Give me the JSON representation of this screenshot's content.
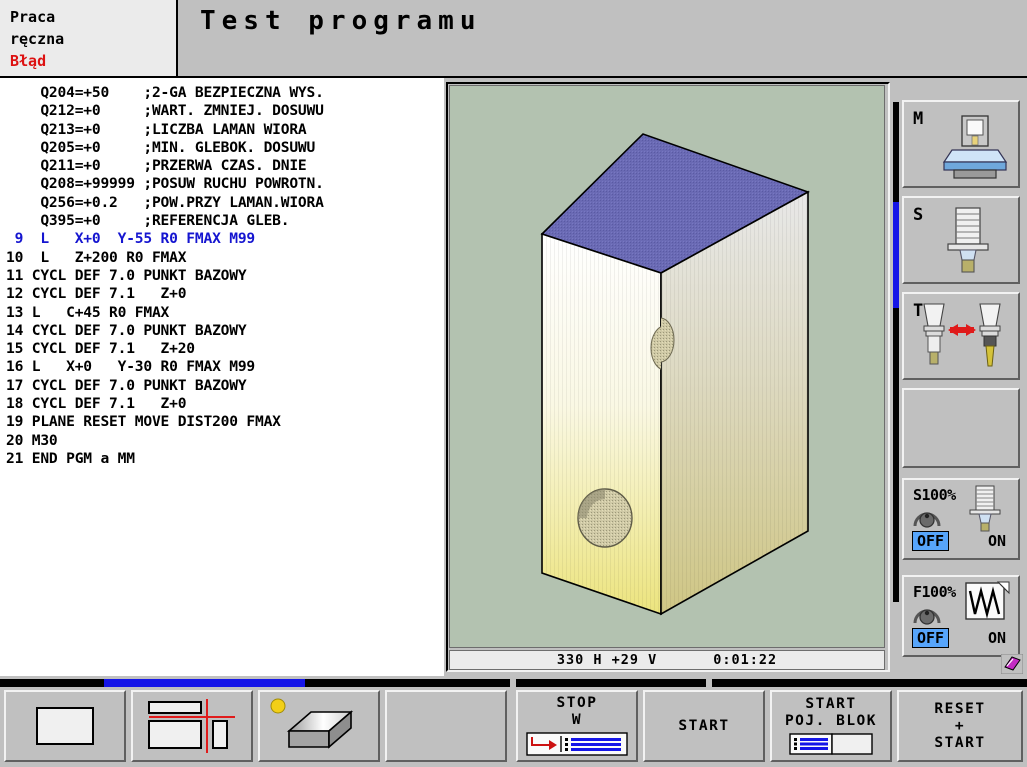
{
  "header": {
    "mode_line1": "Praca",
    "mode_line2": "ręczna",
    "status": "Błąd",
    "title": "Test programu",
    "error_color": "#dd1111"
  },
  "program": {
    "lines": [
      {
        "text": "    Q204=+50    ;2-GA BEZPIECZNA WYS.",
        "highlight": false
      },
      {
        "text": "    Q212=+0     ;WART. ZMNIEJ. DOSUWU",
        "highlight": false
      },
      {
        "text": "    Q213=+0     ;LICZBA LAMAN WIORA",
        "highlight": false
      },
      {
        "text": "    Q205=+0     ;MIN. GLEBOK. DOSUWU",
        "highlight": false
      },
      {
        "text": "    Q211=+0     ;PRZERWA CZAS. DNIE",
        "highlight": false
      },
      {
        "text": "    Q208=+99999 ;POSUW RUCHU POWROTN.",
        "highlight": false
      },
      {
        "text": "    Q256=+0.2   ;POW.PRZY LAMAN.WIORA",
        "highlight": false
      },
      {
        "text": "    Q395=+0     ;REFERENCJA GLEB.",
        "highlight": false
      },
      {
        "text": " 9  L   X+0  Y-55 R0 FMAX M99",
        "highlight": true
      },
      {
        "text": "10  L   Z+200 R0 FMAX",
        "highlight": false
      },
      {
        "text": "11 CYCL DEF 7.0 PUNKT BAZOWY",
        "highlight": false
      },
      {
        "text": "12 CYCL DEF 7.1   Z+0",
        "highlight": false
      },
      {
        "text": "13 L   C+45 R0 FMAX",
        "highlight": false
      },
      {
        "text": "14 CYCL DEF 7.0 PUNKT BAZOWY",
        "highlight": false
      },
      {
        "text": "15 CYCL DEF 7.1   Z+20",
        "highlight": false
      },
      {
        "text": "16 L   X+0   Y-30 R0 FMAX M99",
        "highlight": false
      },
      {
        "text": "17 CYCL DEF 7.0 PUNKT BAZOWY",
        "highlight": false
      },
      {
        "text": "18 CYCL DEF 7.1   Z+0",
        "highlight": false
      },
      {
        "text": "19 PLANE RESET MOVE DIST200 FMAX",
        "highlight": false
      },
      {
        "text": "20 M30",
        "highlight": false
      },
      {
        "text": "21 END PGM a MM",
        "highlight": false
      }
    ]
  },
  "graphics": {
    "background_color": "#b3c2b0",
    "top_face_color": "#6666b0",
    "status": {
      "position": "330 H  +29 V",
      "time": "0:01:22"
    }
  },
  "sidebar": {
    "buttons": [
      {
        "key": "M",
        "icon": "machine-table-icon"
      },
      {
        "key": "S",
        "icon": "spindle-tool-icon"
      },
      {
        "key": "T",
        "icon": "tool-change-icon"
      },
      {
        "key": "",
        "icon": "empty-icon"
      }
    ],
    "overrides": [
      {
        "label": "S100%",
        "icon": "spindle-tool-icon",
        "off": "OFF",
        "on": "ON",
        "active": "OFF"
      },
      {
        "label": "F100%",
        "icon": "feed-waveform-icon",
        "off": "OFF",
        "on": "ON",
        "active": "OFF"
      }
    ],
    "book_icon": "book-icon",
    "highlight_color": "#57a5fb",
    "scrollbar_color": "#1515e8"
  },
  "softkeys": [
    {
      "label": "",
      "icon": "screen-single-icon"
    },
    {
      "label": "",
      "icon": "screen-split-icon"
    },
    {
      "label": "",
      "icon": "workpiece-block-icon"
    },
    {
      "label": "",
      "icon": "none"
    },
    {
      "label_lines": [
        "STOP",
        "W"
      ],
      "icon": "stop-at-block-icon"
    },
    {
      "label_lines": [
        "START"
      ],
      "icon": "none"
    },
    {
      "label_lines": [
        "START",
        "POJ. BLOK"
      ],
      "icon": "single-block-icon"
    },
    {
      "label_lines": [
        "RESET",
        "+",
        "START"
      ],
      "icon": "none"
    }
  ]
}
